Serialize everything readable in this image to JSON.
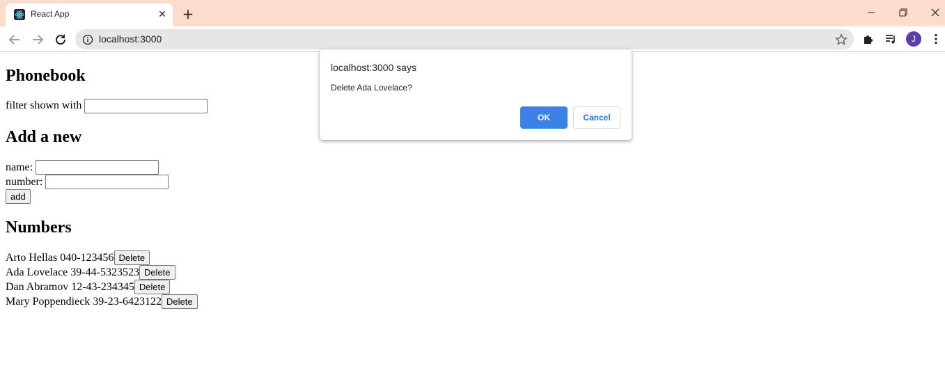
{
  "browser": {
    "tab_title": "React App",
    "url": "localhost:3000",
    "profile_initial": "J",
    "colors": {
      "tabstrip": "#fcdcca",
      "avatar": "#5b3ea6"
    },
    "icons": [
      "react-logo-icon",
      "close-icon",
      "plus-icon",
      "minimize-icon",
      "restore-icon",
      "window-close-icon",
      "back-arrow-icon",
      "forward-arrow-icon",
      "reload-icon",
      "info-icon",
      "star-icon",
      "puzzle-icon",
      "media-queue-icon",
      "kebab-menu-icon"
    ]
  },
  "page": {
    "title": "Phonebook",
    "filter_label": "filter shown with",
    "filter_value": "",
    "add_heading": "Add a new",
    "name_label": "name:",
    "name_value": "",
    "number_label": "number:",
    "number_value": "",
    "add_button": "add",
    "numbers_heading": "Numbers",
    "delete_label": "Delete",
    "persons": [
      {
        "entry": "Arto Hellas 040-123456"
      },
      {
        "entry": "Ada Lovelace 39-44-5323523"
      },
      {
        "entry": "Dan Abramov 12-43-234345"
      },
      {
        "entry": "Mary Poppendieck 39-23-6423122"
      }
    ]
  },
  "dialog": {
    "title": "localhost:3000 says",
    "message": "Delete Ada Lovelace?",
    "ok_label": "OK",
    "cancel_label": "Cancel",
    "ok_color": "#3b82e6"
  }
}
